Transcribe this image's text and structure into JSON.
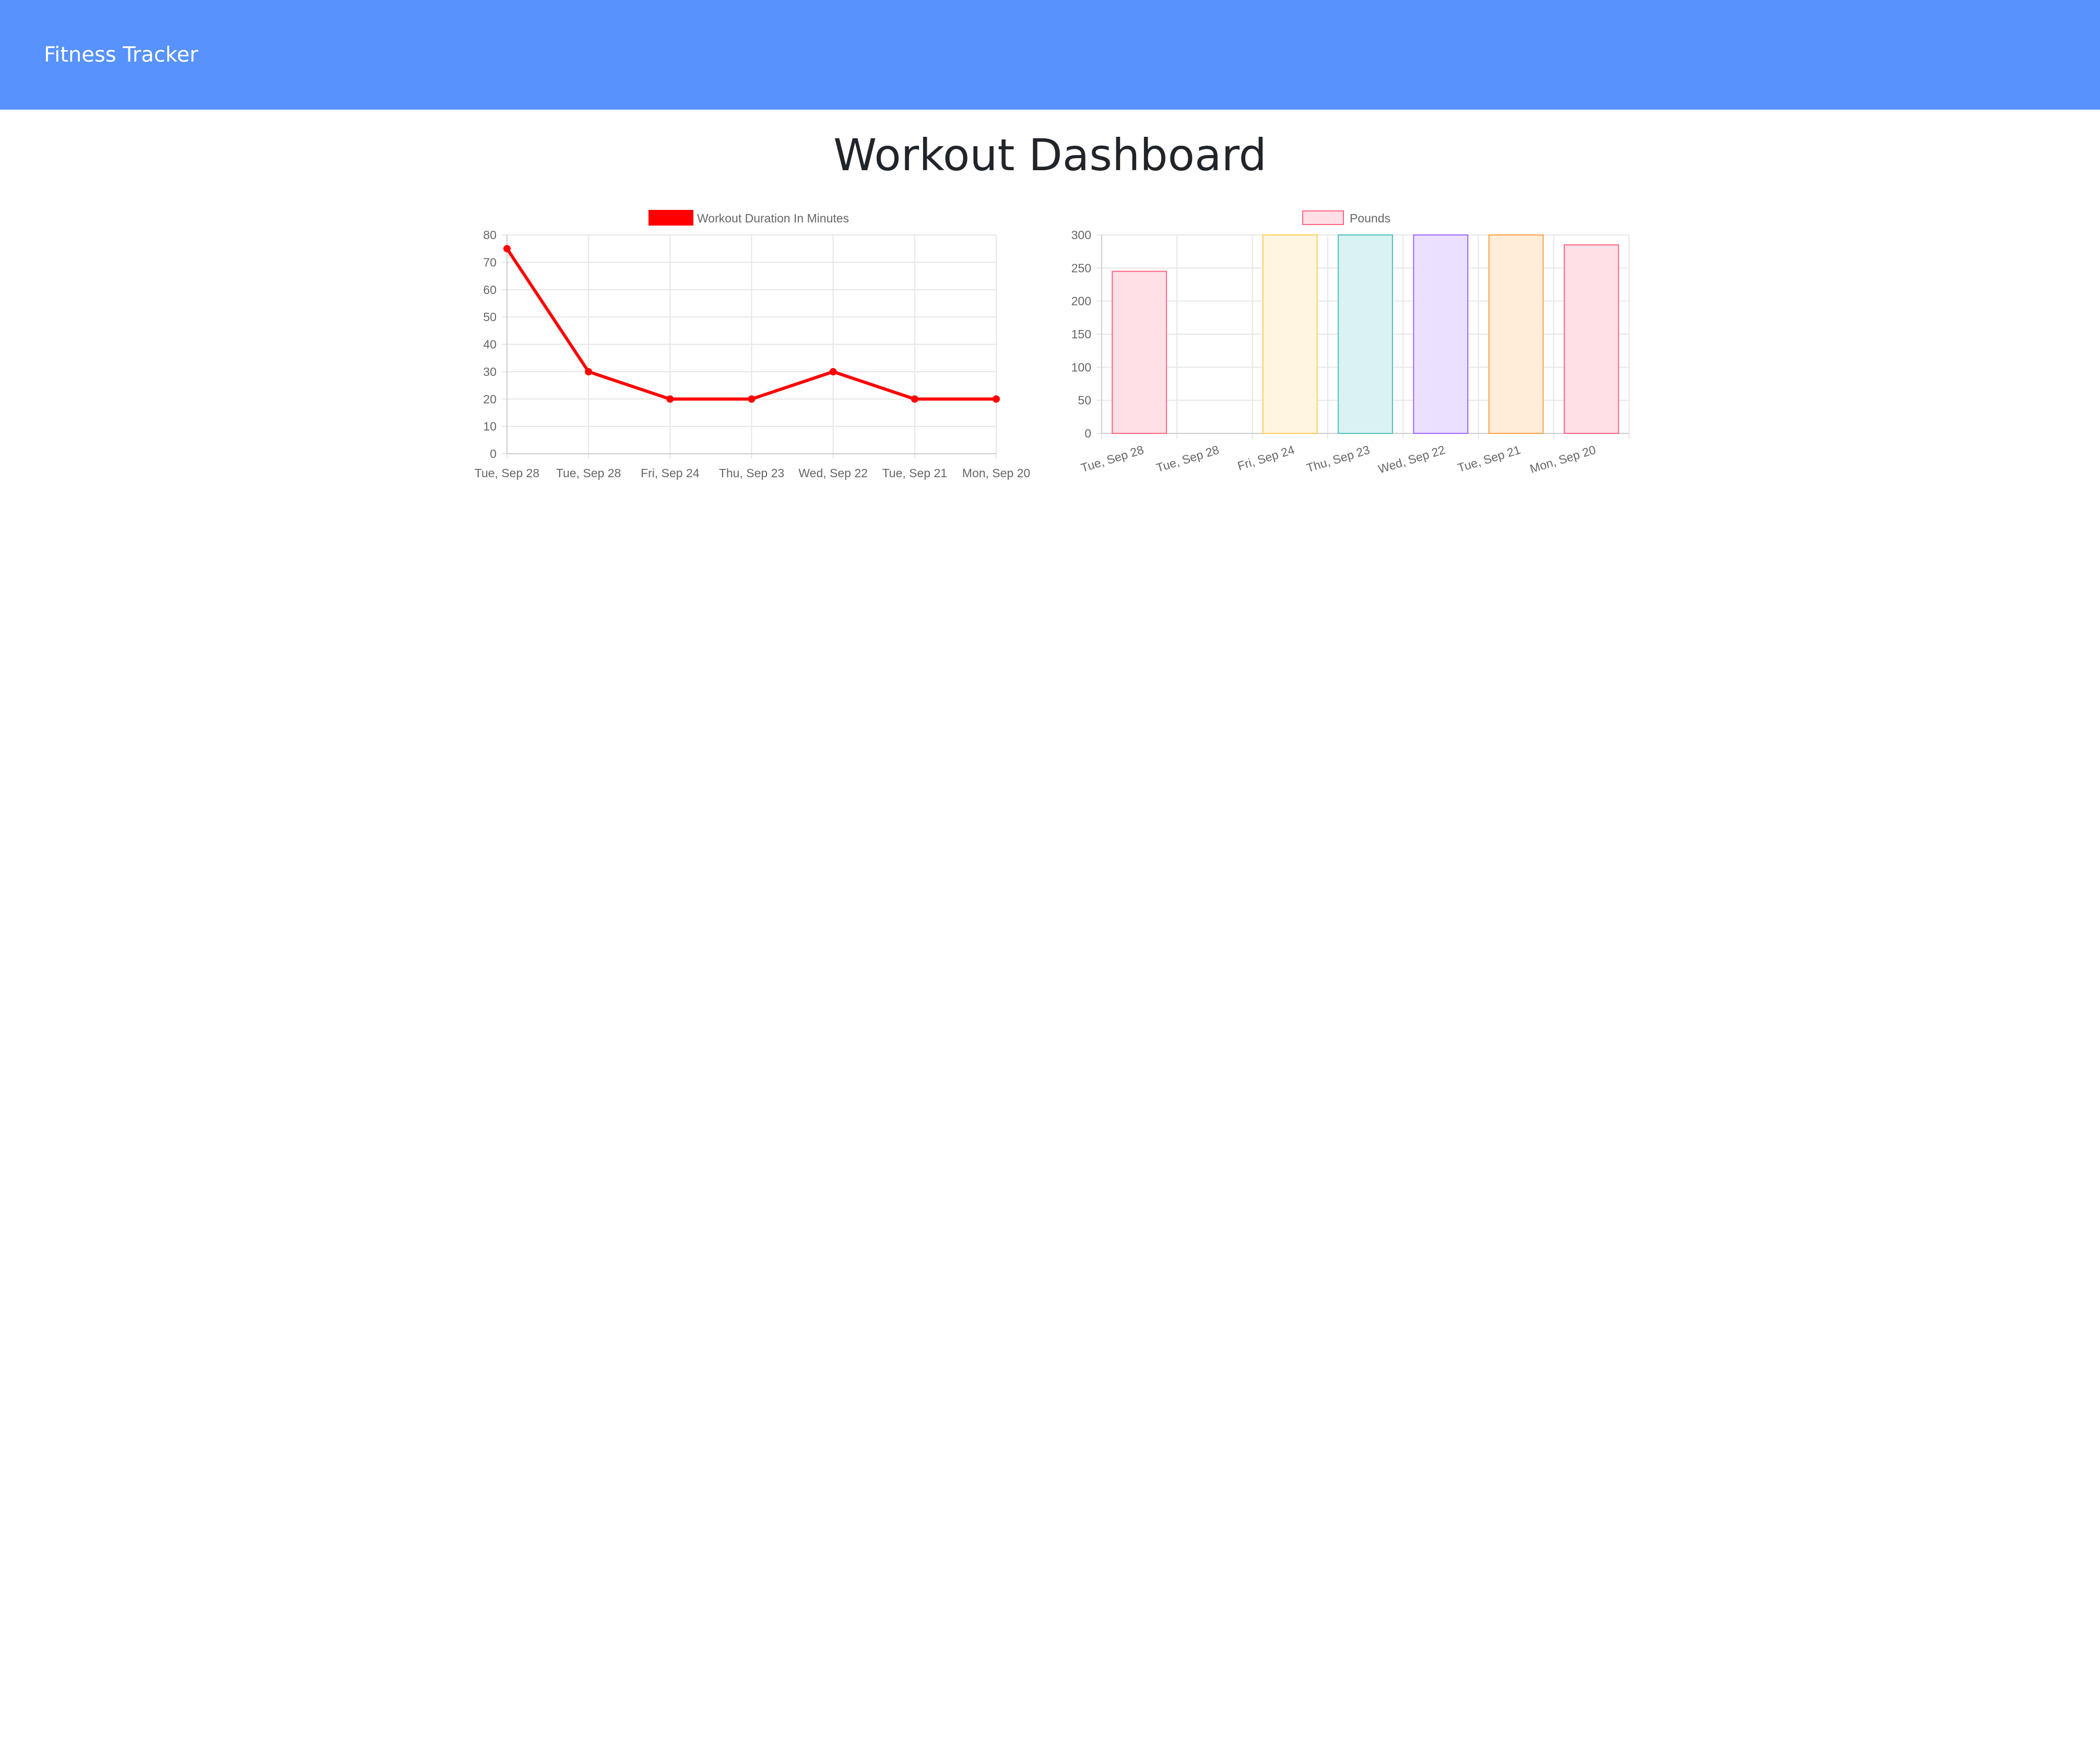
{
  "app": {
    "brand": "Fitness Tracker"
  },
  "page": {
    "title": "Workout Dashboard"
  },
  "charts": {
    "duration": {
      "legend_label": "Workout Duration In Minutes",
      "color": "#ff0000"
    },
    "weight": {
      "legend_label": "Pounds"
    }
  },
  "chart_data": [
    {
      "type": "line",
      "title": "",
      "xlabel": "",
      "ylabel": "",
      "categories": [
        "Tue, Sep 28",
        "Tue, Sep 28",
        "Fri, Sep 24",
        "Thu, Sep 23",
        "Wed, Sep 22",
        "Tue, Sep 21",
        "Mon, Sep 20"
      ],
      "series": [
        {
          "name": "Workout Duration In Minutes",
          "values": [
            75,
            30,
            20,
            20,
            30,
            20,
            20
          ],
          "color": "#ff0000"
        }
      ],
      "ylim": [
        0,
        80
      ],
      "yticks": [
        0,
        10,
        20,
        30,
        40,
        50,
        60,
        70,
        80
      ],
      "grid": true,
      "legend": "top-center"
    },
    {
      "type": "bar",
      "title": "",
      "xlabel": "",
      "ylabel": "",
      "categories": [
        "Tue, Sep 28",
        "Tue, Sep 28",
        "Fri, Sep 24",
        "Thu, Sep 23",
        "Wed, Sep 22",
        "Tue, Sep 21",
        "Mon, Sep 20"
      ],
      "series": [
        {
          "name": "Pounds",
          "values": [
            245,
            0,
            300,
            300,
            300,
            300,
            285
          ],
          "fill_colors": [
            "#ffe0e6",
            "#e1f0fb",
            "#fff5e1",
            "#dbf2f2",
            "#ebe0ff",
            "#ffecd9",
            "#ffe0e6"
          ],
          "stroke_colors": [
            "#ff6384",
            "#36a2eb",
            "#ffce56",
            "#4bc0c0",
            "#9966ff",
            "#ff9f40",
            "#ff6384"
          ]
        }
      ],
      "ylim": [
        0,
        300
      ],
      "yticks": [
        0,
        50,
        100,
        150,
        200,
        250,
        300
      ],
      "grid": true,
      "legend": "top-center",
      "legend_fill": "#ffe0e6",
      "legend_stroke": "#ff6384"
    }
  ]
}
